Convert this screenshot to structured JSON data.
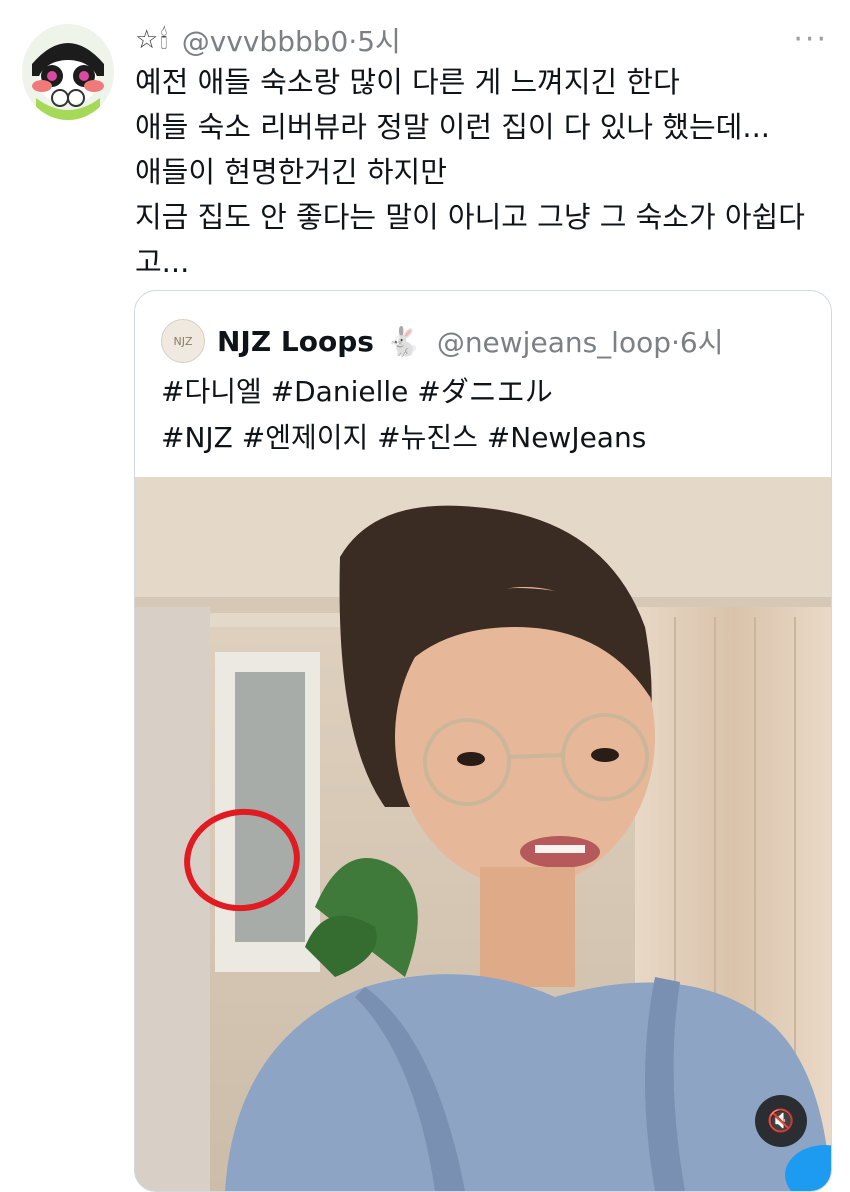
{
  "tweet": {
    "header_icons": "☆🕯",
    "handle_time": "@vvvbbbb0·5시",
    "more": "···",
    "text": "예전 애들 숙소랑 많이 다른 게 느껴지긴 한다\n애들 숙소 리버뷰라 정말 이런 집이 다 있나 했는데...\n애들이 현명한거긴 하지만\n지금 집도 안 좋다는 말이 아니고 그냥 그 숙소가 아쉽다\n고..."
  },
  "quote": {
    "avatar_text": "NJZ",
    "name": "NJZ Loops",
    "rabbit": "🐇",
    "handle_time": "@newjeans_loop·6시",
    "text": "#다니엘 #Danielle #ダニエル\n#NJZ #엔제이지 #뉴진스 #NewJeans",
    "media": {
      "mute_icon": "🔇"
    }
  },
  "colors": {
    "annotation_circle": "#e01b22",
    "link_blue": "#1d9bf0"
  }
}
